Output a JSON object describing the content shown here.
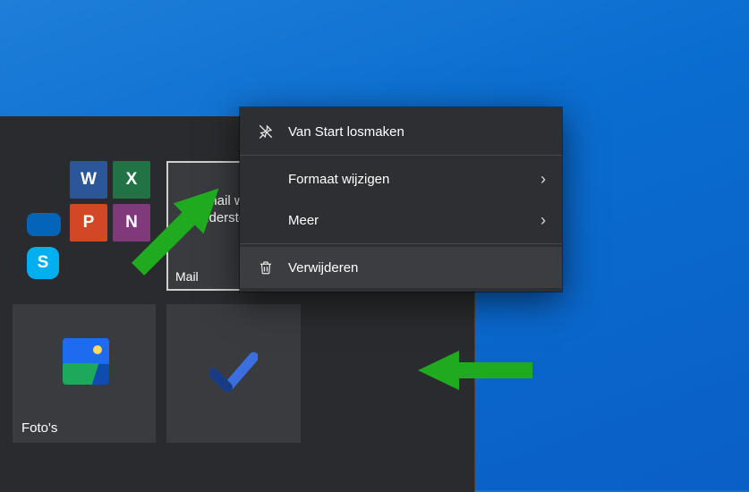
{
  "tiles": {
    "mail": {
      "preview_line1": "Gmail wordt",
      "preview_line2": "ondersteund",
      "label": "Mail"
    },
    "photos": {
      "label": "Foto's"
    },
    "apps": {
      "word": "W",
      "excel": "X",
      "powerpoint": "P",
      "onenote": "N",
      "skype": "S"
    }
  },
  "context_menu": {
    "unpin": "Van Start losmaken",
    "resize": "Formaat wijzigen",
    "more": "Meer",
    "uninstall": "Verwijderen"
  }
}
